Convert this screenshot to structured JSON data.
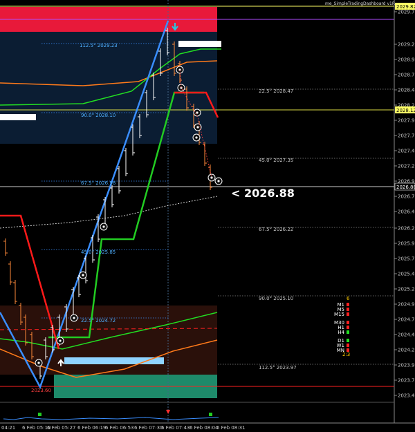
{
  "indicator_title": "me_SimpleTradingDashboard v1R",
  "price_axis": {
    "labels": [
      "2029.70",
      "2029.20",
      "2028.95",
      "2028.70",
      "2028.45",
      "2028.20",
      "2027.95",
      "2027.70",
      "2027.45",
      "2027.20",
      "2026.95",
      "2026.70",
      "2026.45",
      "2026.20",
      "2025.95",
      "2025.70",
      "2025.45",
      "2025.20",
      "2024.95",
      "2024.70",
      "2024.45",
      "2024.20",
      "2023.95",
      "2023.70",
      "2023.45"
    ],
    "badges": [
      {
        "text": "2029.82",
        "bg": "#ffff66",
        "fg": "#000000"
      },
      {
        "text": "2028.12",
        "bg": "#ffff66",
        "fg": "#000000"
      },
      {
        "text": "2026.88",
        "bg": "#000000",
        "fg": "#ffffff"
      }
    ]
  },
  "time_axis": [
    "04:21",
    "6 Feb 05:10",
    "6 Feb 05:27",
    "6 Feb 06:19",
    "6 Feb 06:53",
    "6 Feb 07:30",
    "6 Feb 07:43",
    "6 Feb 08:04",
    "6 Feb 08:31"
  ],
  "current_price_text": "<  2026.88",
  "low_label": "2023.60",
  "fib_levels": [
    {
      "text": "112.5° 2029.23",
      "color": "#4fb0ff"
    },
    {
      "text": "90.0° 2028.10",
      "color": "#4fb0ff"
    },
    {
      "text": "67.5° 2026.98",
      "color": "#4fb0ff"
    },
    {
      "text": "45.0° 2025.85",
      "color": "#4fb0ff"
    },
    {
      "text": "22.5° 2024.72",
      "color": "#4fb0ff"
    },
    {
      "text": "22.5° 2028.47",
      "color": "#c8c8c8"
    },
    {
      "text": "45.0° 2027.35",
      "color": "#c8c8c8"
    },
    {
      "text": "67.5° 2026.22",
      "color": "#c8c8c8"
    },
    {
      "text": "90.0° 2025.10",
      "color": "#c8c8c8"
    },
    {
      "text": "112.5° 2023.97",
      "color": "#c8c8c8"
    }
  ],
  "dashboard": {
    "count": "6",
    "rows": [
      {
        "label": "M1",
        "color": "#ff2020"
      },
      {
        "label": "M5",
        "color": "#ff2020"
      },
      {
        "label": "M15",
        "color": "#ff2020"
      },
      {
        "label": "M30",
        "color": "#ff2020"
      },
      {
        "label": "H1",
        "color": "#ff2020"
      },
      {
        "label": "H4",
        "color": "#22dd22"
      },
      {
        "label": "D1",
        "color": "#22dd22"
      },
      {
        "label": "W1",
        "color": "#ff2020"
      },
      {
        "label": "MN",
        "color": "#ff2020"
      }
    ],
    "ratio": "2:3"
  },
  "colors": {
    "bear_line": "#ff1a1a",
    "bull_line": "#22cc22",
    "fan_line": "#3a8eff",
    "supply_zone": "#e8193a",
    "demand_zone": "#1e8a6a"
  }
}
